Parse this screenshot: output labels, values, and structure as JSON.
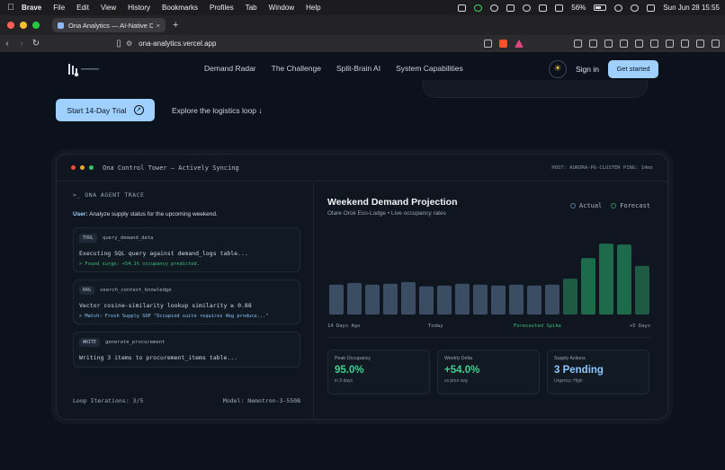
{
  "menubar": {
    "app": "Brave",
    "items": [
      "File",
      "Edit",
      "View",
      "History",
      "Bookmarks",
      "Profiles",
      "Tab",
      "Window",
      "Help"
    ],
    "battery": "56%",
    "clock": "Sun Jun 28  15:55"
  },
  "browser": {
    "tab_title": "Ona Analytics — AI-Native De",
    "url": "ona-analytics.vercel.app",
    "colors": {
      "close": "#ff5f57",
      "minimize": "#febc2e",
      "maximize": "#28c840"
    }
  },
  "site": {
    "nav_links": [
      "Demand Radar",
      "The Challenge",
      "Split-Brain AI",
      "System Capabilities"
    ],
    "sign_in": "Sign in",
    "get_started": "Get started",
    "trial_button": "Start 14-Day Trial",
    "explore_link": "Explore the logistics loop ↓"
  },
  "tower": {
    "title": "Ona Control Tower — Actively Syncing",
    "host_info": "HOST: AURORA-PG-CLUSTER  PING: 14ms",
    "trace": {
      "heading": ">_ ONA AGENT TRACE",
      "user_label": "User:",
      "user_text": "Analyze supply status for the upcoming weekend.",
      "steps": [
        {
          "badge": "TOOL",
          "name": "query_demand_data",
          "line1": "Executing SQL query against demand_logs table...",
          "line2": "> Found surge: +54.1% occupancy predicted.",
          "line2_color": "#3fbf7f"
        },
        {
          "badge": "RAG",
          "name": "search_context_knowledge",
          "line1": "Vector cosine-similarity lookup similarity ≥ 0.88",
          "line2": "> Match: Fresh Supply SOP \"Occupied suite requires 4kg produce...\"",
          "line2_color": "#8cc4f5"
        },
        {
          "badge": "WRITE",
          "name": "generate_procurement",
          "line1": "Writing 3 items to procurement_items table...",
          "line2": "",
          "line2_color": "#8cc4f5"
        }
      ],
      "footer_left": "Loop Iterations: 3/5",
      "footer_right": "Model: Nemotron-3-550B"
    },
    "projection": {
      "title": "Weekend Demand Projection",
      "subtitle": "Olare Orok Eco-Lodge • Live occupancy rates",
      "legend_actual": "Actual",
      "legend_forecast": "Forecast",
      "x_labels": [
        "14 Days Ago",
        "Today",
        "Forecasted Spike",
        "+5 Days"
      ],
      "stats": [
        {
          "label": "Peak Occupancy",
          "value": "95.0%",
          "sub": "in 3 days",
          "color": "#3fd18f"
        },
        {
          "label": "Weekly Delta",
          "value": "+54.0%",
          "sub": "vs prior avg",
          "color": "#3fd18f"
        },
        {
          "label": "Supply Actions",
          "value": "3 Pending",
          "sub": "Urgency: High",
          "color": "#8cc8ff"
        }
      ]
    }
  },
  "chart_data": {
    "type": "bar",
    "series": [
      {
        "name": "Actual",
        "values": [
          35,
          37,
          35,
          36,
          38,
          33,
          34,
          36,
          35,
          34,
          35,
          34,
          35,
          null,
          null,
          null,
          null,
          null
        ]
      },
      {
        "name": "Forecast",
        "values": [
          null,
          null,
          null,
          null,
          null,
          null,
          null,
          null,
          null,
          null,
          null,
          null,
          null,
          42,
          66,
          83,
          82,
          57
        ]
      }
    ],
    "colors": {
      "actual": "#3a4d63",
      "forecast": "#1f5a44",
      "forecast_bright": "#1e6b4b"
    },
    "ylim": [
      0,
      100
    ],
    "grid": false,
    "legend": "top-right"
  }
}
